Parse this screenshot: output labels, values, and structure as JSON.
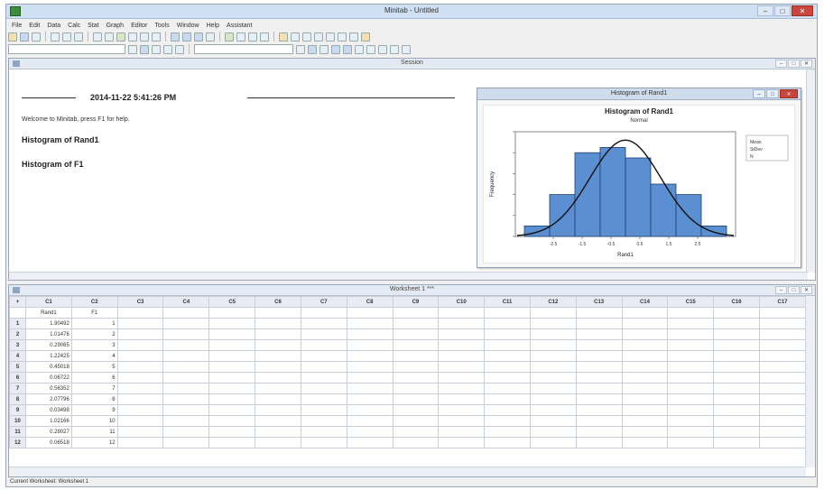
{
  "app": {
    "title": "Minitab - Untitled"
  },
  "menu": [
    "File",
    "Edit",
    "Data",
    "Calc",
    "Stat",
    "Graph",
    "Editor",
    "Tools",
    "Window",
    "Help",
    "Assistant"
  ],
  "session": {
    "title": "Session",
    "timestamp": "2014-11-22 5:41:26 PM",
    "welcome": "Welcome to Minitab, press F1 for help.",
    "headings": [
      "Histogram of Rand1",
      "Histogram of F1"
    ]
  },
  "graph_window": {
    "title": "Histogram of Rand1"
  },
  "chart_data": {
    "type": "bar",
    "title": "Histogram of Rand1",
    "subtitle": "Normal",
    "xlabel": "Rand1",
    "ylabel": "Frequency",
    "categories": [
      "-2.5",
      "-1.5",
      "-0.5",
      "0.5",
      "1.5",
      "2.5"
    ],
    "values": [
      1,
      4,
      8,
      8.5,
      7.5,
      5,
      4,
      1
    ],
    "legend": [
      "Mean",
      "StDev",
      "N"
    ],
    "curve": "normal",
    "ylim": [
      0,
      10
    ],
    "xlim": [
      -3,
      3
    ],
    "grid": false,
    "legend_placement": "top-right"
  },
  "worksheet": {
    "title": "Worksheet 1 ***",
    "columns": [
      "C1",
      "C2",
      "C3",
      "C4",
      "C5",
      "C6",
      "C7",
      "C8",
      "C9",
      "C10",
      "C11",
      "C12",
      "C13",
      "C14",
      "C15",
      "C16",
      "C17"
    ],
    "names": [
      "Rand1",
      "F1"
    ],
    "rows": [
      {
        "n": "1",
        "c1": "1.90492",
        "c2": "1"
      },
      {
        "n": "2",
        "c1": "1.01476",
        "c2": "2"
      },
      {
        "n": "3",
        "c1": "0.29065",
        "c2": "3"
      },
      {
        "n": "4",
        "c1": "1.22425",
        "c2": "4"
      },
      {
        "n": "5",
        "c1": "0.45018",
        "c2": "5"
      },
      {
        "n": "6",
        "c1": "0.06722",
        "c2": "6"
      },
      {
        "n": "7",
        "c1": "0.56352",
        "c2": "7"
      },
      {
        "n": "8",
        "c1": "2.07796",
        "c2": "8"
      },
      {
        "n": "9",
        "c1": "0.03498",
        "c2": "9"
      },
      {
        "n": "10",
        "c1": "1.02166",
        "c2": "10"
      },
      {
        "n": "11",
        "c1": "0.28027",
        "c2": "11"
      },
      {
        "n": "12",
        "c1": "0.06518",
        "c2": "12"
      }
    ]
  },
  "status": {
    "text": "Current Worksheet: Worksheet 1"
  }
}
